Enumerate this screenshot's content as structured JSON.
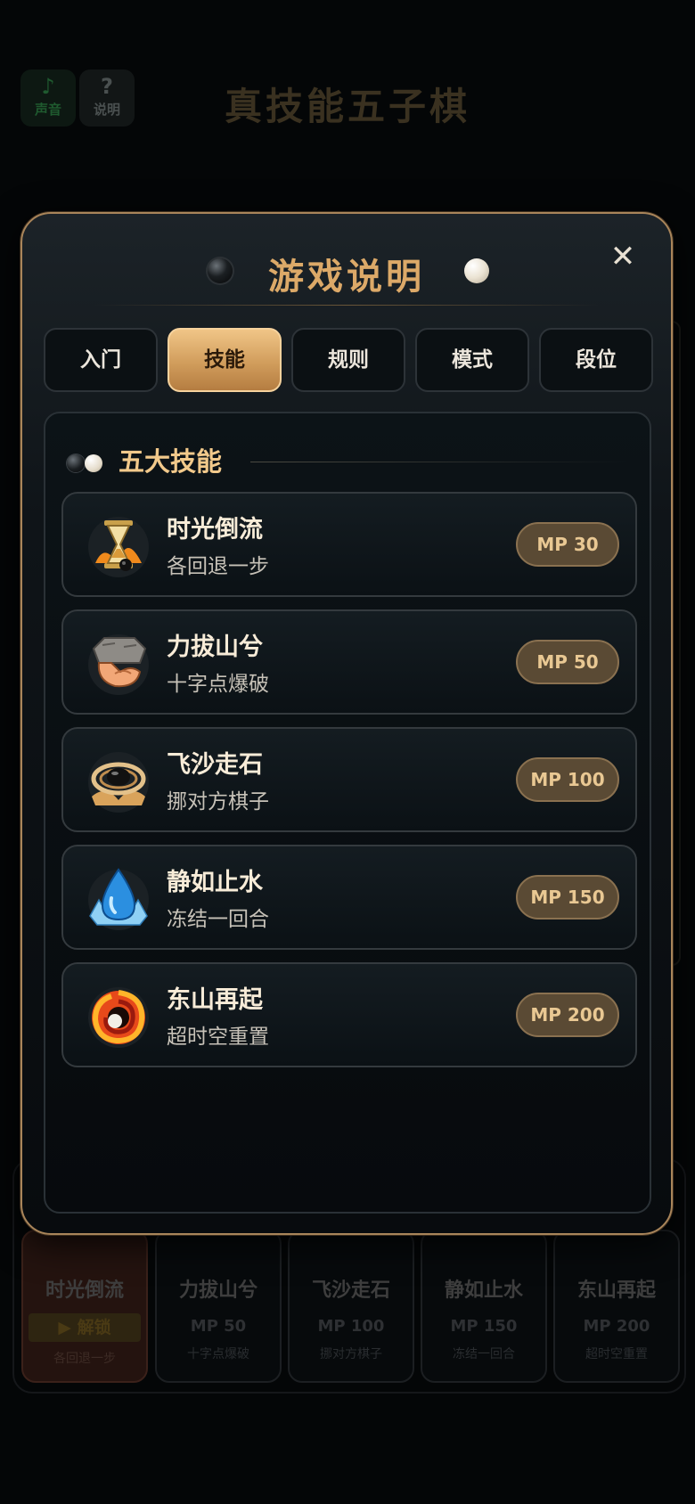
{
  "background": {
    "sound_button": {
      "icon": "music-note-icon",
      "label": "声音"
    },
    "help_button": {
      "icon": "question-icon",
      "label": "说明"
    },
    "game_title": "真技能五子棋",
    "skill_cards": [
      {
        "name": "时光倒流",
        "action": "▶ 解锁",
        "desc": "各回退一步"
      },
      {
        "name": "力拔山兮",
        "mp": "MP 50",
        "desc": "十字点爆破"
      },
      {
        "name": "飞沙走石",
        "mp": "MP 100",
        "desc": "挪对方棋子"
      },
      {
        "name": "静如止水",
        "mp": "MP 150",
        "desc": "冻结一回合"
      },
      {
        "name": "东山再起",
        "mp": "MP 200",
        "desc": "超时空重置"
      }
    ]
  },
  "modal": {
    "title": "游戏说明",
    "close_glyph": "✕",
    "tabs": [
      {
        "label": "入门"
      },
      {
        "label": "技能"
      },
      {
        "label": "规则"
      },
      {
        "label": "模式"
      },
      {
        "label": "段位"
      }
    ],
    "active_tab": "技能",
    "section_title": "五大技能",
    "skills": [
      {
        "name": "时光倒流",
        "desc": "各回退一步",
        "mp": "MP 30",
        "icon": "hourglass-icon"
      },
      {
        "name": "力拔山兮",
        "desc": "十字点爆破",
        "mp": "MP 50",
        "icon": "strong-arm-rock-icon"
      },
      {
        "name": "飞沙走石",
        "desc": "挪对方棋子",
        "mp": "MP 100",
        "icon": "whirlwind-stone-icon"
      },
      {
        "name": "静如止水",
        "desc": "冻结一回合",
        "mp": "MP 150",
        "icon": "water-drop-icon"
      },
      {
        "name": "东山再起",
        "desc": "超时空重置",
        "mp": "MP 200",
        "icon": "fire-vortex-icon"
      }
    ]
  },
  "colors": {
    "accent_gold": "#dca968",
    "modal_border": "#a9855a",
    "badge_bg": "#5a4a34",
    "badge_text": "#e9c893"
  }
}
